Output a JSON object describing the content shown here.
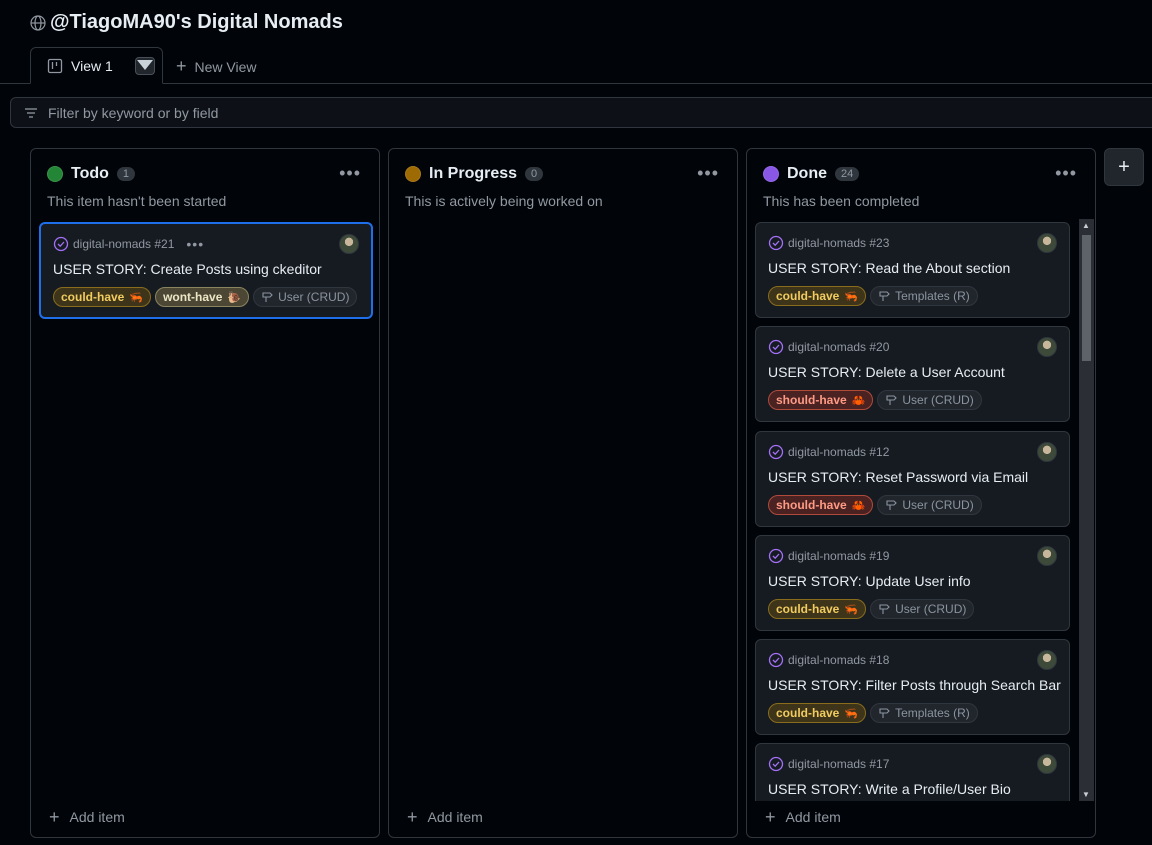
{
  "project": {
    "title": "@TiagoMA90's Digital Nomads",
    "icon": "globe-icon"
  },
  "tabs": {
    "active_label": "View 1",
    "new_view_label": "New View"
  },
  "filter": {
    "placeholder": "Filter by keyword or by field"
  },
  "add_item_label": "Add item",
  "columns": [
    {
      "name": "Todo",
      "count": "1",
      "description": "This item hasn't been started",
      "color": "#238636",
      "cards": [
        {
          "meta": "digital-nomads #21",
          "title": "USER STORY: Create Posts using ckeditor",
          "labels": [
            "could-have",
            "wont-have",
            "User (CRUD)"
          ]
        }
      ]
    },
    {
      "name": "In Progress",
      "count": "0",
      "description": "This is actively being worked on",
      "color": "#9e6a03",
      "cards": []
    },
    {
      "name": "Done",
      "count": "24",
      "description": "This has been completed",
      "color": "#8957e5",
      "cards": [
        {
          "meta": "digital-nomads #23",
          "title": "USER STORY: Read the About section",
          "labels": [
            "could-have",
            "Templates (R)"
          ]
        },
        {
          "meta": "digital-nomads #20",
          "title": "USER STORY: Delete a User Account",
          "labels": [
            "should-have",
            "User (CRUD)"
          ]
        },
        {
          "meta": "digital-nomads #12",
          "title": "USER STORY: Reset Password via Email",
          "labels": [
            "should-have",
            "User (CRUD)"
          ]
        },
        {
          "meta": "digital-nomads #19",
          "title": "USER STORY: Update User info",
          "labels": [
            "could-have",
            "User (CRUD)"
          ]
        },
        {
          "meta": "digital-nomads #18",
          "title": "USER STORY: Filter Posts through Search Bar",
          "labels": [
            "could-have",
            "Templates (R)"
          ]
        },
        {
          "meta": "digital-nomads #17",
          "title": "USER STORY: Write a Profile/User Bio",
          "labels": []
        }
      ]
    }
  ],
  "colors": {
    "accent": "#1f6feb",
    "background": "#010409",
    "card": "#161b22"
  }
}
